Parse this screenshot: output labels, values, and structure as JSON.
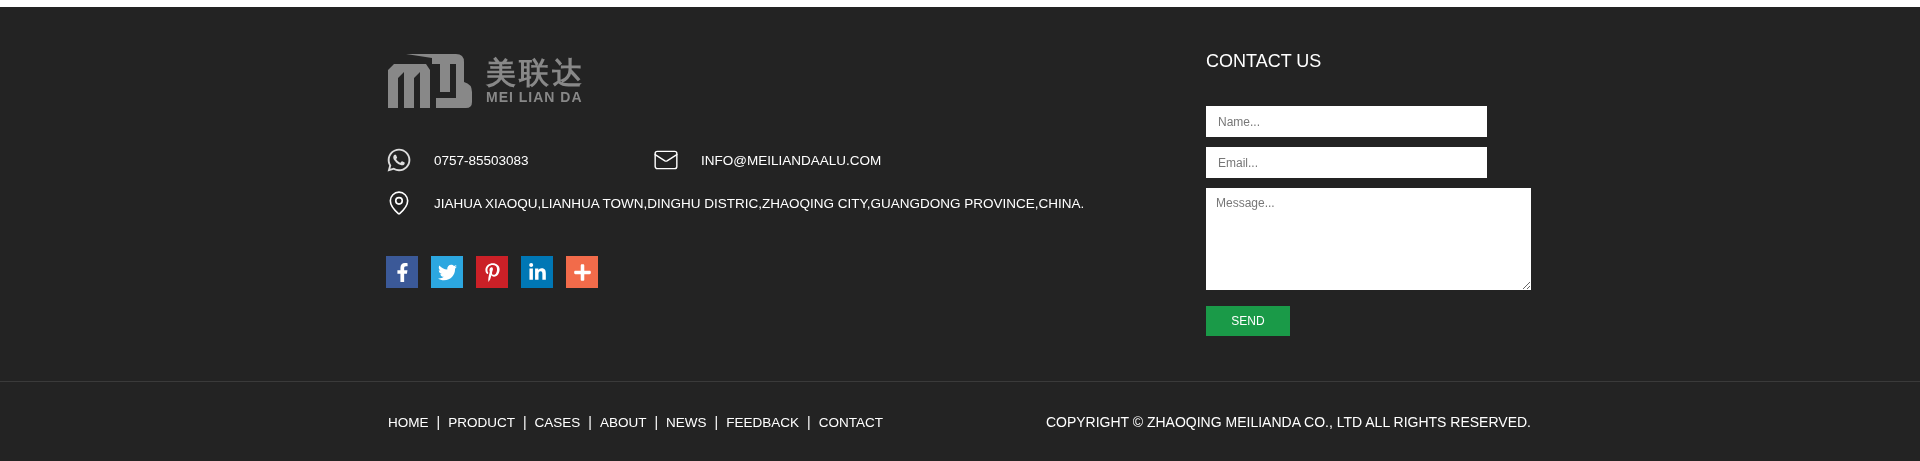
{
  "logo": {
    "chinese": "美联达",
    "latin": "MEI LIAN DA"
  },
  "contacts": [
    {
      "kind": "phone",
      "text": "0757-85503083"
    },
    {
      "kind": "email",
      "text": "INFO@MEILIANDAALU.COM"
    },
    {
      "kind": "address",
      "text": "JIAHUA XIAOQU,LIANHUA TOWN,DINGHU DISTRIC,ZHAOQING CITY,GUANGDONG PROVINCE,CHINA."
    }
  ],
  "social": [
    {
      "kind": "facebook",
      "color": "#3b5998"
    },
    {
      "kind": "twitter",
      "color": "#2ca7e0"
    },
    {
      "kind": "pinterest",
      "color": "#cb2027"
    },
    {
      "kind": "linkedin",
      "color": "#0077b5"
    },
    {
      "kind": "plus",
      "color": "#f26b4a"
    }
  ],
  "contact_form": {
    "title": "CONTACT US",
    "name": {
      "placeholder": "Name..."
    },
    "email": {
      "placeholder": "Email..."
    },
    "message": {
      "placeholder": "Message..."
    },
    "submit": "SEND"
  },
  "nav": [
    {
      "label": "HOME"
    },
    {
      "label": "PRODUCT"
    },
    {
      "label": "CASES"
    },
    {
      "label": "ABOUT"
    },
    {
      "label": "NEWS"
    },
    {
      "label": "FEEDBACK"
    },
    {
      "label": "CONTACT"
    }
  ],
  "nav_separators": [
    "|",
    "|",
    "|",
    "|",
    "|",
    "|"
  ],
  "copyright": "COPYRIGHT © ZHAOQING MEILIANDA CO., LTD ALL RIGHTS RESERVED."
}
